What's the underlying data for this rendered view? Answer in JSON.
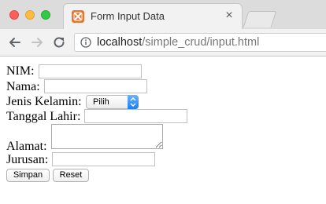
{
  "browser": {
    "tab_title": "Form Input Data",
    "tab_close": "×",
    "url_host": "localhost",
    "url_path": "/simple_crud/input.html"
  },
  "form": {
    "nim_label": "NIM:",
    "nim_value": "",
    "nama_label": "Nama:",
    "nama_value": "",
    "jenis_kelamin_label": "Jenis Kelamin:",
    "jenis_kelamin_selected": "Pilih",
    "tanggal_lahir_label": "Tanggal Lahir:",
    "tanggal_lahir_value": "",
    "alamat_label": "Alamat:",
    "alamat_value": "",
    "jurusan_label": "Jurusan:",
    "jurusan_value": "",
    "simpan_label": "Simpan",
    "reset_label": "Reset"
  },
  "colors": {
    "select_accent": "#1a7ef5",
    "favicon": "#e8762f"
  }
}
